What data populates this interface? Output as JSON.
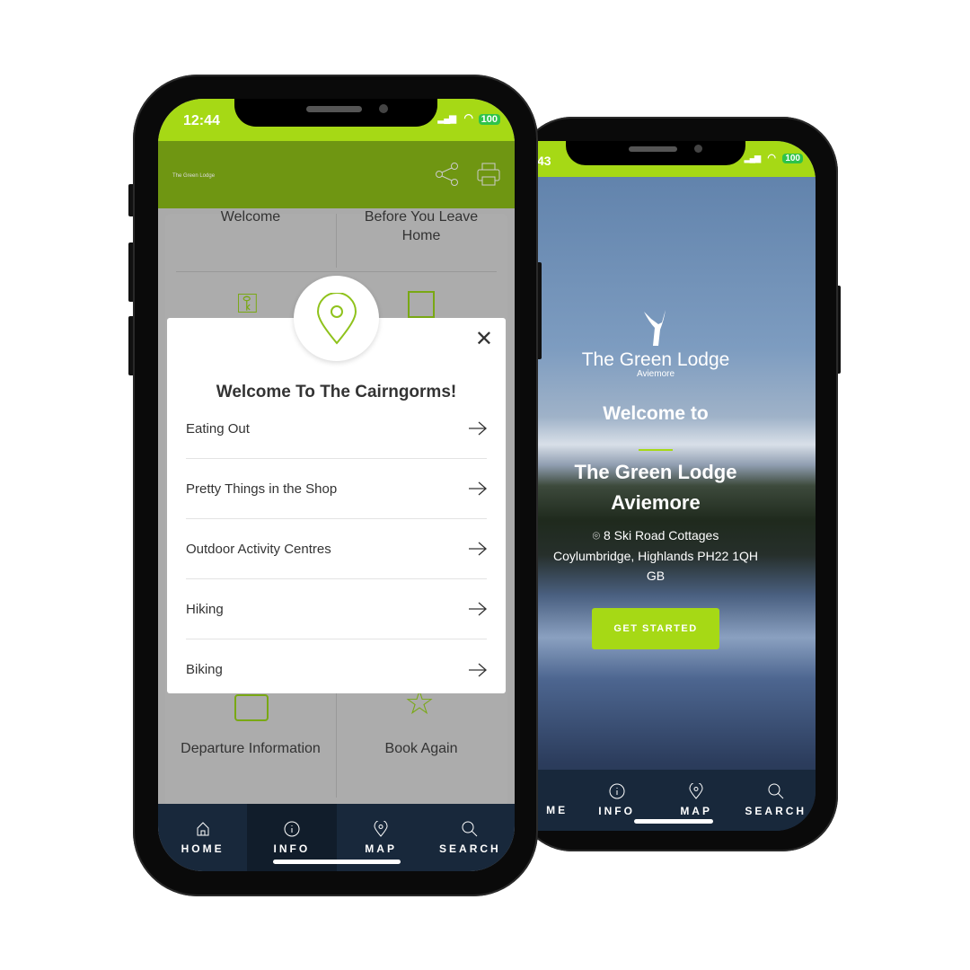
{
  "colors": {
    "accent": "#a6d915",
    "nav": "#18283b",
    "header_dim": "#6f9612"
  },
  "back_phone": {
    "status": {
      "time": "12:43",
      "time_visible": "43",
      "battery": "100"
    },
    "logo": {
      "name": "The Green Lodge",
      "sub": "Aviemore"
    },
    "welcome": "Welcome to",
    "title_line1": "The Green Lodge",
    "title_line2": "Aviemore",
    "address": {
      "line1": "8 Ski Road Cottages",
      "line2": "Coylumbridge, Highlands PH22 1QH",
      "line3": "GB"
    },
    "cta": "GET STARTED",
    "nav": [
      {
        "label": "ME",
        "icon": "home-icon"
      },
      {
        "label": "INFO",
        "icon": "info-icon"
      },
      {
        "label": "MAP",
        "icon": "map-pin-icon"
      },
      {
        "label": "SEARCH",
        "icon": "search-icon"
      }
    ]
  },
  "front_phone": {
    "status": {
      "time": "12:44",
      "battery": "100"
    },
    "header": {
      "logo": "The Green Lodge",
      "share_icon": "share-icon",
      "print_icon": "printer-icon"
    },
    "grid": {
      "welcome": "Welcome",
      "before_leave": "Before You Leave Home",
      "departure": "Departure Information",
      "book_again": "Book Again"
    },
    "modal": {
      "title": "Welcome To The Cairngorms!",
      "icon": "map-pin-icon",
      "items": [
        "Eating Out",
        "Pretty Things in the Shop",
        "Outdoor Activity Centres",
        "Hiking",
        "Biking"
      ]
    },
    "nav": [
      {
        "label": "HOME",
        "icon": "home-icon"
      },
      {
        "label": "INFO",
        "icon": "info-icon",
        "active": true
      },
      {
        "label": "MAP",
        "icon": "map-pin-icon"
      },
      {
        "label": "SEARCH",
        "icon": "search-icon"
      }
    ]
  }
}
